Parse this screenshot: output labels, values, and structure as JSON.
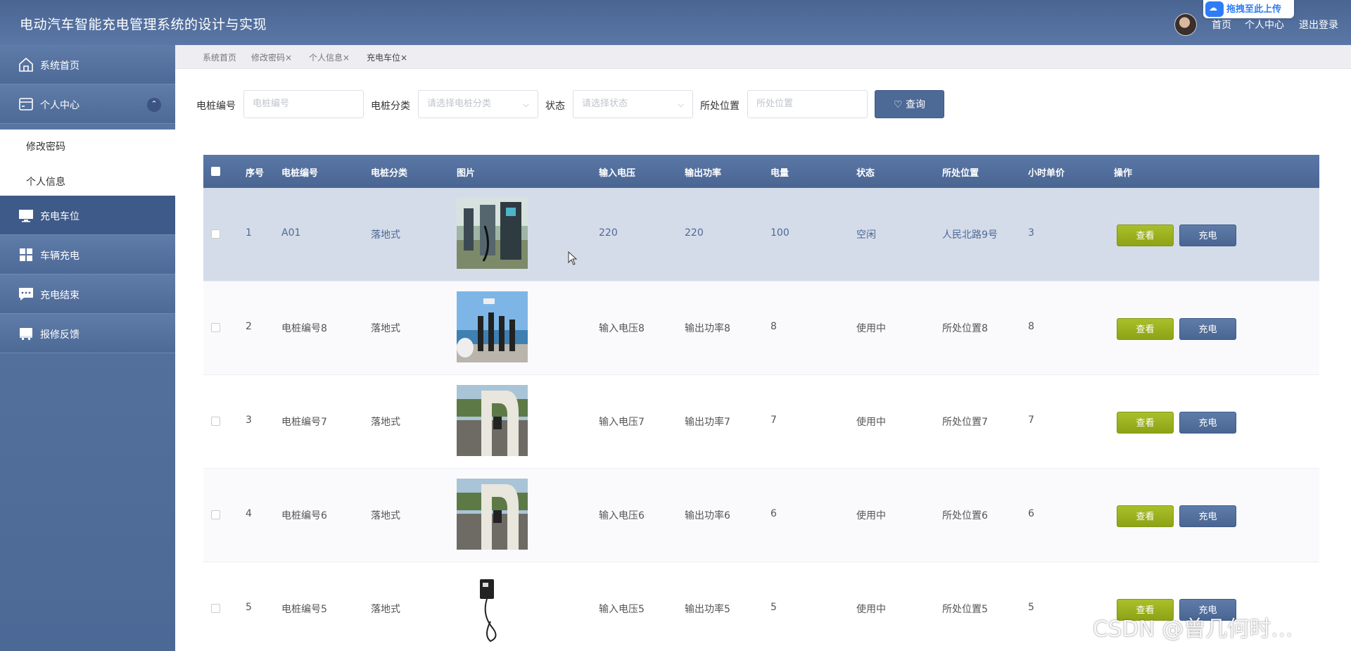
{
  "header": {
    "title": "电动汽车智能充电管理系统的设计与实现",
    "nav": [
      "首页",
      "个人中心",
      "退出登录"
    ],
    "upload_badge": "拖拽至此上传"
  },
  "sidebar": {
    "items": [
      {
        "label": "系统首页",
        "icon": "home-icon"
      },
      {
        "label": "个人中心",
        "icon": "card-icon"
      },
      {
        "label": "充电车位",
        "icon": "monitor-icon"
      },
      {
        "label": "车辆充电",
        "icon": "grid-icon"
      },
      {
        "label": "充电结束",
        "icon": "chat-icon"
      },
      {
        "label": "报修反馈",
        "icon": "tray-icon"
      }
    ],
    "submenu": [
      "修改密码",
      "个人信息"
    ]
  },
  "tabs": [
    {
      "label": "系统首页"
    },
    {
      "label": "修改密码×"
    },
    {
      "label": "个人信息×"
    },
    {
      "label": "充电车位×"
    }
  ],
  "search": {
    "fields": [
      {
        "label": "电桩编号",
        "placeholder": "电桩编号"
      },
      {
        "label": "电桩分类",
        "placeholder": "请选择电桩分类"
      },
      {
        "label": "状态",
        "placeholder": "请选择状态"
      },
      {
        "label": "所处位置",
        "placeholder": "所处位置"
      }
    ],
    "button": "查询"
  },
  "table": {
    "columns": [
      "序号",
      "电桩编号",
      "电桩分类",
      "图片",
      "输入电压",
      "输出功率",
      "电量",
      "状态",
      "所处位置",
      "小时单价",
      "操作"
    ],
    "rows": [
      {
        "no": "1",
        "code": "A01",
        "type": "落地式",
        "voltage": "220",
        "power": "220",
        "battery": "100",
        "status": "空闲",
        "location": "人民北路9号",
        "price": "3"
      },
      {
        "no": "2",
        "code": "电桩编号8",
        "type": "落地式",
        "voltage": "输入电压8",
        "power": "输出功率8",
        "battery": "8",
        "status": "使用中",
        "location": "所处位置8",
        "price": "8"
      },
      {
        "no": "3",
        "code": "电桩编号7",
        "type": "落地式",
        "voltage": "输入电压7",
        "power": "输出功率7",
        "battery": "7",
        "status": "使用中",
        "location": "所处位置7",
        "price": "7"
      },
      {
        "no": "4",
        "code": "电桩编号6",
        "type": "落地式",
        "voltage": "输入电压6",
        "power": "输出功率6",
        "battery": "6",
        "status": "使用中",
        "location": "所处位置6",
        "price": "6"
      },
      {
        "no": "5",
        "code": "电桩编号5",
        "type": "落地式",
        "voltage": "输入电压5",
        "power": "输出功率5",
        "battery": "5",
        "status": "使用中",
        "location": "所处位置5",
        "price": "5"
      }
    ],
    "view_label": "查看",
    "charge_label": "充电"
  },
  "watermark": "CSDN @曾几何时…",
  "colors": {
    "primary": "#4d6996",
    "view_button": "#9bb21f",
    "highlight_row": "#d5dce9"
  }
}
